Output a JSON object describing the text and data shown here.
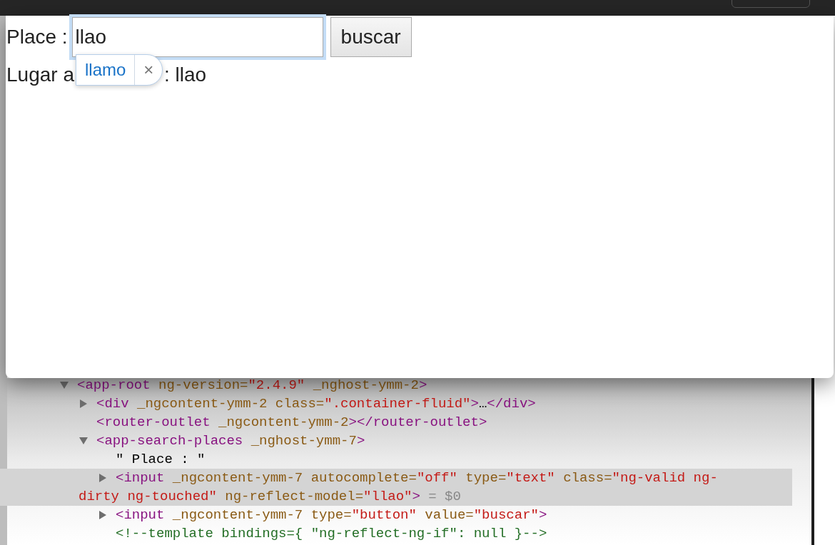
{
  "form": {
    "label": "Place :",
    "input_value": "llao",
    "button": "buscar"
  },
  "result": {
    "visible_start": "Lugar a",
    "visible_end": ": llao"
  },
  "autocomplete": {
    "suggestion": "llamo",
    "dismiss": "×"
  },
  "dom_tree": [
    {
      "kind": "toggle",
      "expanded": true,
      "selected": false,
      "tokens": [
        {
          "kind": "tag",
          "text": "<app-root"
        },
        {
          "kind": "attr",
          "text": " ng-version="
        },
        {
          "kind": "value",
          "text": "\"2.4.9\""
        },
        {
          "kind": "attr",
          "text": " _nghost-ymm-2"
        },
        {
          "kind": "tag",
          "text": ">"
        }
      ],
      "children": [
        {
          "kind": "toggle",
          "expanded": false,
          "selected": false,
          "tokens": [
            {
              "kind": "tag",
              "text": "<div"
            },
            {
              "kind": "attr",
              "text": " _ngcontent-ymm-2 class="
            },
            {
              "kind": "value",
              "text": "\".container-fluid\""
            },
            {
              "kind": "tag",
              "text": ">"
            },
            {
              "kind": "text",
              "text": "…"
            },
            {
              "kind": "tag",
              "text": "</div>"
            }
          ]
        },
        {
          "kind": "leaf",
          "selected": false,
          "tokens": [
            {
              "kind": "tag",
              "text": "<router-outlet"
            },
            {
              "kind": "attr",
              "text": " _ngcontent-ymm-2"
            },
            {
              "kind": "tag",
              "text": "></router-outlet>"
            }
          ]
        },
        {
          "kind": "toggle",
          "expanded": true,
          "selected": false,
          "tokens": [
            {
              "kind": "tag",
              "text": "<app-search-places"
            },
            {
              "kind": "attr",
              "text": " _nghost-ymm-7"
            },
            {
              "kind": "tag",
              "text": ">"
            }
          ],
          "children": [
            {
              "kind": "leaf",
              "selected": false,
              "tokens": [
                {
                  "kind": "text",
                  "text": "\" Place : \""
                }
              ]
            },
            {
              "kind": "toggle",
              "expanded": false,
              "selected": true,
              "tokens": [
                {
                  "kind": "tag",
                  "text": "<input"
                },
                {
                  "kind": "attr",
                  "text": " _ngcontent-ymm-7 autocomplete="
                },
                {
                  "kind": "value",
                  "text": "\"off\""
                },
                {
                  "kind": "attr",
                  "text": " type="
                },
                {
                  "kind": "value",
                  "text": "\"text\""
                },
                {
                  "kind": "attr",
                  "text": " class="
                },
                {
                  "kind": "value",
                  "text": "\"ng-valid ng-dirty ng-touched\""
                },
                {
                  "kind": "attr",
                  "text": " ng-reflect-model="
                },
                {
                  "kind": "value",
                  "text": "\"llao\""
                },
                {
                  "kind": "tag",
                  "text": ">"
                },
                {
                  "kind": "ref",
                  "text": " = $0"
                }
              ]
            },
            {
              "kind": "toggle",
              "expanded": false,
              "selected": false,
              "tokens": [
                {
                  "kind": "tag",
                  "text": "<input"
                },
                {
                  "kind": "attr",
                  "text": " _ngcontent-ymm-7 type="
                },
                {
                  "kind": "value",
                  "text": "\"button\""
                },
                {
                  "kind": "attr",
                  "text": " value="
                },
                {
                  "kind": "value",
                  "text": "\"buscar\""
                },
                {
                  "kind": "tag",
                  "text": ">"
                }
              ]
            },
            {
              "kind": "leaf",
              "selected": false,
              "tokens": [
                {
                  "kind": "comment",
                  "text": "<!--template bindings={ \"ng-reflect-ng-if\": null }-->"
                }
              ]
            }
          ]
        }
      ]
    }
  ]
}
